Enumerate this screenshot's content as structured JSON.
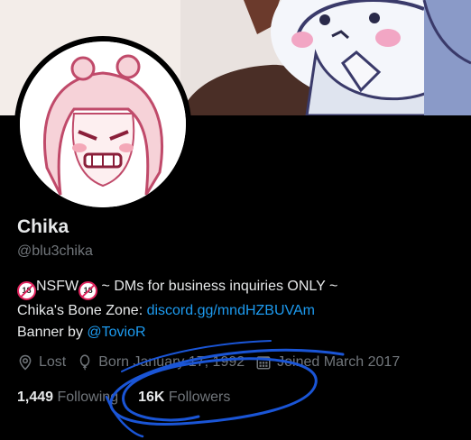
{
  "profile": {
    "name": "Chika",
    "handle": "@blu3chika",
    "bio_line1_text": "NSFW",
    "bio_line1_badge": "18",
    "bio_line1_rest": " ~ DMs for business inquiries ONLY ~",
    "bio_line2_prefix": "Chika's Bone Zone: ",
    "bio_line2_link": "discord.gg/mndHZBUVAm",
    "bio_line3_prefix": "Banner by ",
    "bio_line3_link": "@TovioR"
  },
  "meta": {
    "location": "Lost",
    "born": "Born January 17, 1992",
    "joined": "Joined March 2017"
  },
  "stats": {
    "following_count": "1,449",
    "following_label": "Following",
    "followers_count": "16K",
    "followers_label": "Followers"
  },
  "colors": {
    "accent": "#1d9bf0",
    "scribble": "#1a55d6"
  }
}
